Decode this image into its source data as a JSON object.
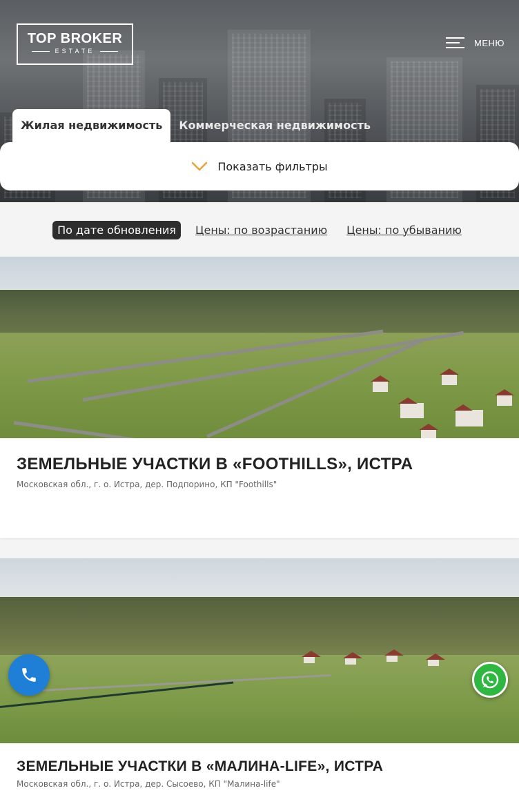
{
  "header": {
    "logo": {
      "line1": "TOP BROKER",
      "line2": "ESTATE"
    },
    "menu_label": "МЕНЮ",
    "tabs": [
      {
        "label": "Жилая недвижимость",
        "active": true
      },
      {
        "label": "Коммерческая недвижимость",
        "active": false
      }
    ]
  },
  "filters": {
    "label": "Показать фильтры"
  },
  "sort": {
    "options": [
      {
        "label": "По дате обновления",
        "active": true
      },
      {
        "label": "Цены: по возрастанию",
        "active": false
      },
      {
        "label": "Цены: по убыванию",
        "active": false
      }
    ]
  },
  "listings": [
    {
      "title": "ЗЕМЕЛЬНЫЕ УЧАСТКИ В «FOOTHILLS», ИСТРА",
      "address": "Московская обл., г. о. Истра, дер. Подпорино, КП \"Foothills\""
    },
    {
      "title": "ЗЕМЕЛЬНЫЕ УЧАСТКИ В «МАЛИНА-LIFE», ИСТРА",
      "address": "Московская обл., г. о. Истра, дер. Сысоево, КП \"Малина-life\""
    }
  ],
  "floating": {
    "phone_icon": "phone-icon",
    "whatsapp_icon": "whatsapp-icon"
  },
  "colors": {
    "phone_button": "#1f7fd6",
    "whatsapp_button": "#2fb742",
    "active_sort": "#2d2d2d"
  }
}
